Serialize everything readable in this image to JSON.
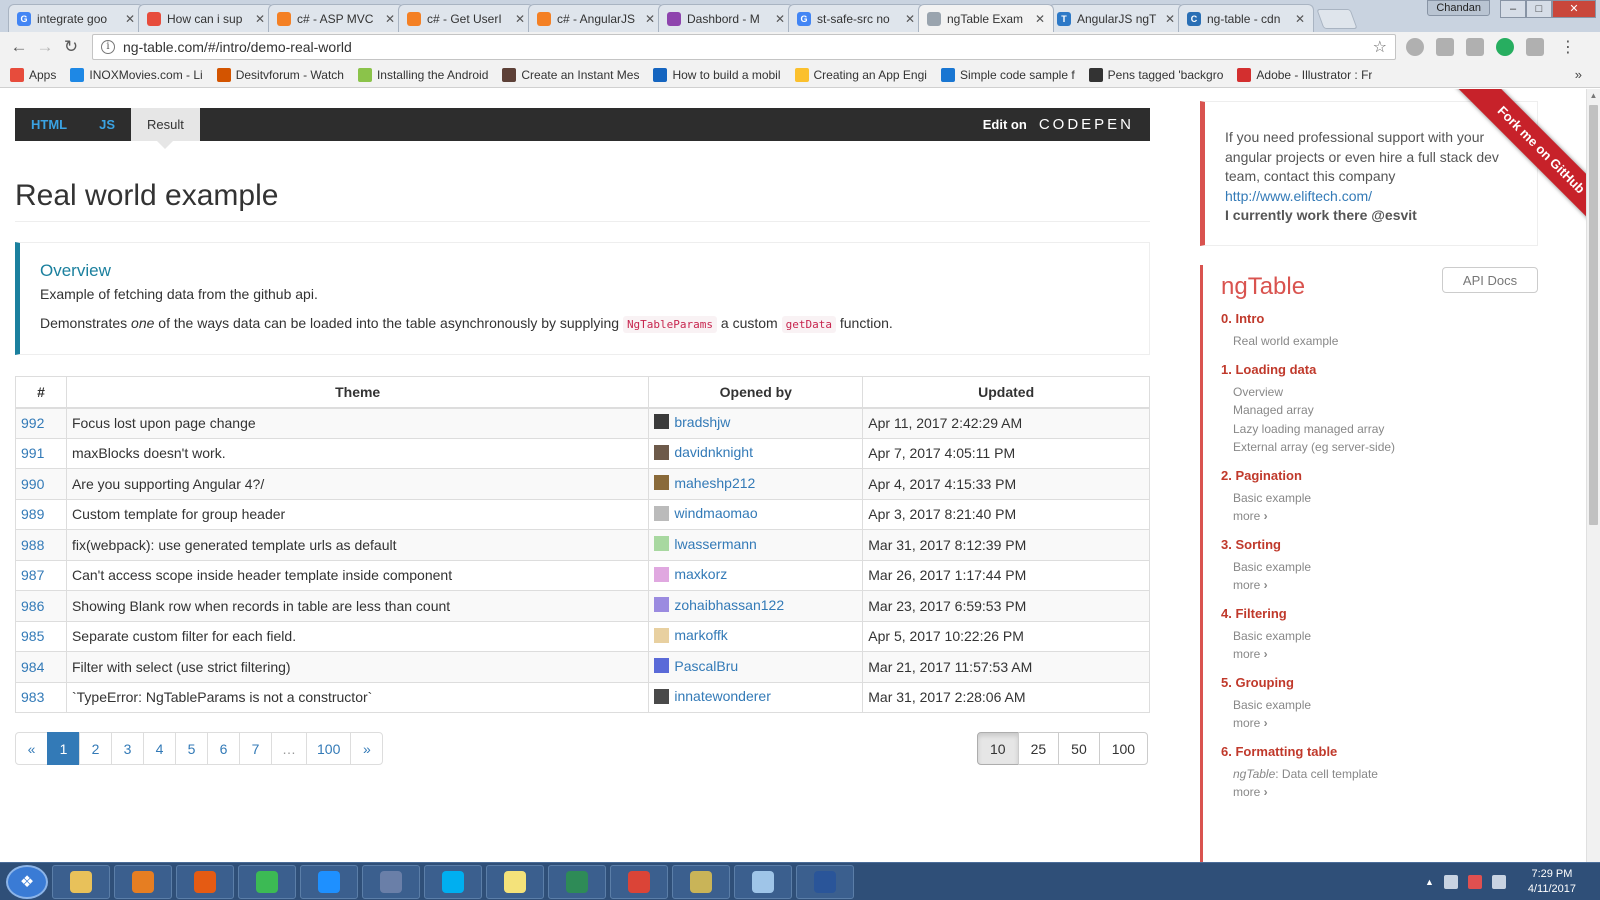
{
  "browser": {
    "tabs": [
      {
        "label": "integrate goo",
        "favicon": "google-icon",
        "color": "#4285f4",
        "glyph": "G",
        "active": false
      },
      {
        "label": "How can i sup",
        "favicon": "windows-icon",
        "color": "#e74c3c",
        "glyph": "",
        "active": false
      },
      {
        "label": "c# - ASP MVC",
        "favicon": "stackoverflow-icon",
        "color": "#f48024",
        "glyph": "",
        "active": false
      },
      {
        "label": "c# - Get UserI",
        "favicon": "stackoverflow-icon",
        "color": "#f48024",
        "glyph": "",
        "active": false
      },
      {
        "label": "c# - AngularJS",
        "favicon": "stackoverflow-icon",
        "color": "#f48024",
        "glyph": "",
        "active": false
      },
      {
        "label": "Dashbord - M",
        "favicon": "app-icon",
        "color": "#8e44ad",
        "glyph": "",
        "active": false
      },
      {
        "label": "st-safe-src no",
        "favicon": "google-icon",
        "color": "#4285f4",
        "glyph": "G",
        "active": false
      },
      {
        "label": "ngTable Exam",
        "favicon": "page-icon",
        "color": "#9aa4ae",
        "glyph": "",
        "active": true
      },
      {
        "label": "AngularJS ngT",
        "favicon": "ts-icon",
        "color": "#2d79c7",
        "glyph": "T",
        "active": false
      },
      {
        "label": "ng-table - cdn",
        "favicon": "cdn-icon",
        "color": "#2a6fb5",
        "glyph": "C",
        "active": false
      }
    ],
    "user": "Chandan",
    "url": "ng-table.com/#/intro/demo-real-world",
    "bookmarks": [
      {
        "label": "Apps",
        "icon": "apps-grid-icon",
        "color": "#e74c3c"
      },
      {
        "label": "INOXMovies.com - Li",
        "icon": "inox-icon",
        "color": "#1e88e5"
      },
      {
        "label": "Desitvforum - Watch",
        "icon": "desi-icon",
        "color": "#d35400"
      },
      {
        "label": "Installing the Android",
        "icon": "android-icon",
        "color": "#8bc34a"
      },
      {
        "label": "Create an Instant Mes",
        "icon": "book-icon",
        "color": "#5d4037"
      },
      {
        "label": "How to build a mobil",
        "icon": "chrome-icon",
        "color": "#1565c0"
      },
      {
        "label": "Creating an App Engi",
        "icon": "appengine-icon",
        "color": "#fbc02d"
      },
      {
        "label": "Simple code sample f",
        "icon": "grid-icon",
        "color": "#1976d2"
      },
      {
        "label": "Pens tagged 'backgro",
        "icon": "codepen-icon",
        "color": "#333333"
      },
      {
        "label": "Adobe - Illustrator : Fr",
        "icon": "adobe-icon",
        "color": "#d32f2f"
      }
    ]
  },
  "codepen": {
    "tabs": [
      "HTML",
      "JS",
      "Result"
    ],
    "edit_label": "Edit on",
    "logo": "CODEPEN"
  },
  "main": {
    "title": "Real world example",
    "overview": {
      "heading": "Overview",
      "line1": "Example of fetching data from the github api.",
      "line2_a": "Demonstrates ",
      "line2_em": "one",
      "line2_b": " of the ways data can be loaded into the table asynchronously by supplying ",
      "code1": "NgTableParams",
      "line2_c": " a custom ",
      "code2": "getData",
      "line2_d": " function."
    },
    "table": {
      "headers": [
        "#",
        "Theme",
        "Opened by",
        "Updated"
      ],
      "rows": [
        {
          "num": "992",
          "theme": "Focus lost upon page change",
          "user": "bradshjw",
          "avatar": "#3b3b3b",
          "updated": "Apr 11, 2017 2:42:29 AM"
        },
        {
          "num": "991",
          "theme": "maxBlocks doesn't work.",
          "user": "davidnknight",
          "avatar": "#6d5a4a",
          "updated": "Apr 7, 2017 4:05:11 PM"
        },
        {
          "num": "990",
          "theme": "Are you supporting Angular 4?/",
          "user": "maheshp212",
          "avatar": "#8a6a3a",
          "updated": "Apr 4, 2017 4:15:33 PM"
        },
        {
          "num": "989",
          "theme": "Custom template for group header",
          "user": "windmaomao",
          "avatar": "#bbbbbb",
          "updated": "Apr 3, 2017 8:21:40 PM"
        },
        {
          "num": "988",
          "theme": "fix(webpack): use generated template urls as default",
          "user": "lwassermann",
          "avatar": "#a8d8a0",
          "updated": "Mar 31, 2017 8:12:39 PM"
        },
        {
          "num": "987",
          "theme": "Can't access scope inside header template inside component",
          "user": "maxkorz",
          "avatar": "#e0a8e0",
          "updated": "Mar 26, 2017 1:17:44 PM"
        },
        {
          "num": "986",
          "theme": "Showing Blank row when records in table are less than count",
          "user": "zohaibhassan122",
          "avatar": "#9b8be0",
          "updated": "Mar 23, 2017 6:59:53 PM"
        },
        {
          "num": "985",
          "theme": "Separate custom filter for each field.",
          "user": "markoffk",
          "avatar": "#e8d0a0",
          "updated": "Apr 5, 2017 10:22:26 PM"
        },
        {
          "num": "984",
          "theme": "Filter with select (use strict filtering)",
          "user": "PascalBru",
          "avatar": "#5a6ad8",
          "updated": "Mar 21, 2017 11:57:53 AM"
        },
        {
          "num": "983",
          "theme": "`TypeError: NgTableParams is not a constructor`",
          "user": "innatewonderer",
          "avatar": "#4a4a4a",
          "updated": "Mar 31, 2017 2:28:06 AM"
        }
      ]
    },
    "pagination": {
      "prev": "«",
      "pages": [
        "1",
        "2",
        "3",
        "4",
        "5",
        "6",
        "7",
        "…",
        "100"
      ],
      "active_page": "1",
      "next": "»"
    },
    "page_sizes": [
      "10",
      "25",
      "50",
      "100"
    ],
    "active_size": "10"
  },
  "sidebar": {
    "support_text": "If you need professional support with your angular projects or even hire a full stack dev team, contact this company",
    "support_link": "http://www.eliftech.com/",
    "support_strong": "I currently work there @esvit",
    "ribbon": "Fork me on GitHub",
    "api_docs": "API Docs",
    "nav_title": "ngTable",
    "more_label": "more",
    "sections": [
      {
        "title": "0. Intro",
        "items": [
          "Real world example"
        ],
        "more": false
      },
      {
        "title": "1. Loading data",
        "items": [
          "Overview",
          "Managed array",
          "Lazy loading managed array",
          "External array (eg server-side)"
        ],
        "more": false
      },
      {
        "title": "2. Pagination",
        "items": [
          "Basic example"
        ],
        "more": true
      },
      {
        "title": "3. Sorting",
        "items": [
          "Basic example"
        ],
        "more": true
      },
      {
        "title": "4. Filtering",
        "items": [
          "Basic example"
        ],
        "more": true
      },
      {
        "title": "5. Grouping",
        "items": [
          "Basic example"
        ],
        "more": true
      },
      {
        "title": "6. Formatting table",
        "items": [],
        "em_item": {
          "em": "ngTable",
          "rest": ": Data cell template"
        },
        "more": true
      }
    ]
  },
  "taskbar": {
    "apps": [
      {
        "name": "explorer-icon",
        "color": "#e8c15a"
      },
      {
        "name": "media-player-icon",
        "color": "#e67e22"
      },
      {
        "name": "firefox-icon",
        "color": "#e55b13"
      },
      {
        "name": "chrome-icon",
        "color": "#3cba54"
      },
      {
        "name": "ie-icon",
        "color": "#1e90ff"
      },
      {
        "name": "network-icon",
        "color": "#6a7fa8"
      },
      {
        "name": "skype-icon",
        "color": "#00aff0"
      },
      {
        "name": "sticky-notes-icon",
        "color": "#f4e27a"
      },
      {
        "name": "visual-studio-icon",
        "color": "#2e8b57"
      },
      {
        "name": "chrome-icon",
        "color": "#db4437"
      },
      {
        "name": "tools-icon",
        "color": "#c9b458"
      },
      {
        "name": "notepad-icon",
        "color": "#9fc5e8"
      },
      {
        "name": "powershell-icon",
        "color": "#2a5599"
      }
    ],
    "time": "7:29 PM",
    "date": "4/11/2017"
  }
}
